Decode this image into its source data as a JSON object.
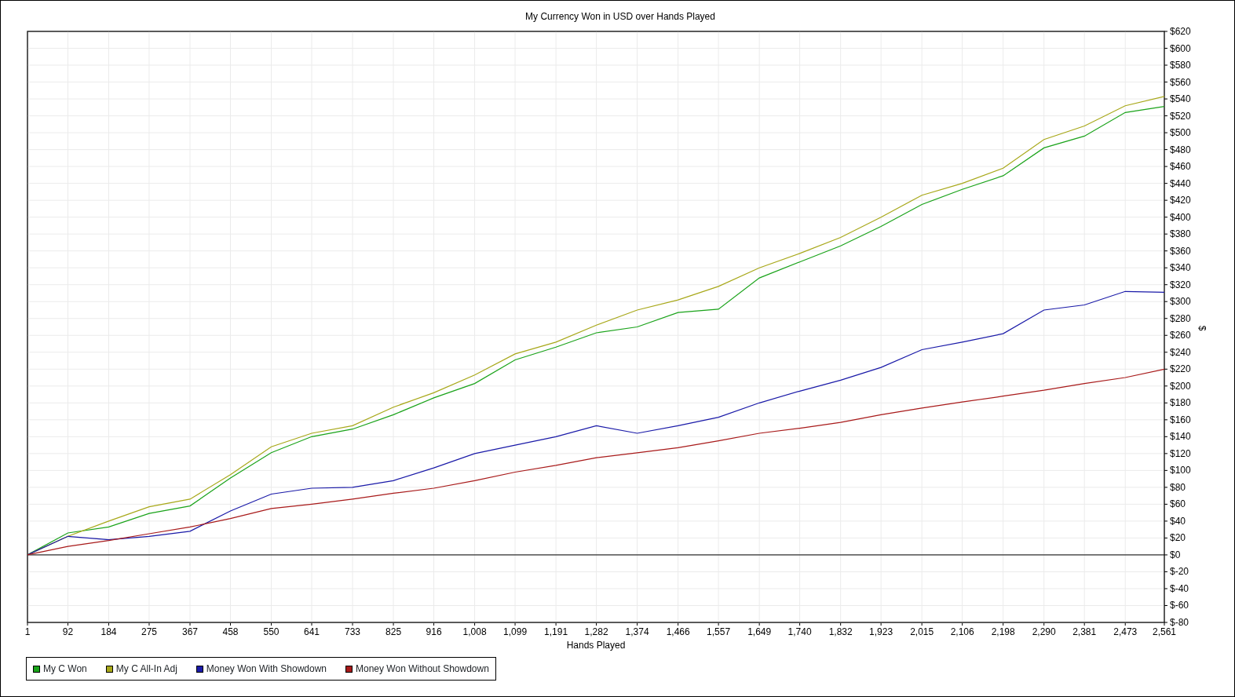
{
  "chart_data": {
    "type": "line",
    "title": "My Currency Won in USD over Hands Played",
    "xlabel": "Hands Played",
    "ylabel": "$",
    "x": [
      1,
      92,
      184,
      275,
      367,
      458,
      550,
      641,
      733,
      825,
      916,
      1008,
      1099,
      1191,
      1282,
      1374,
      1466,
      1557,
      1649,
      1740,
      1832,
      1923,
      2015,
      2106,
      2198,
      2290,
      2381,
      2473,
      2561
    ],
    "series": [
      {
        "name": "My C Won",
        "color": "#1aa31a",
        "values": [
          0,
          26,
          33,
          49,
          58,
          91,
          121,
          140,
          149,
          166,
          186,
          203,
          231,
          246,
          263,
          270,
          287,
          291,
          328,
          347,
          366,
          389,
          415,
          433,
          449,
          482,
          496,
          524,
          531
        ]
      },
      {
        "name": "My C All-In Adj",
        "color": "#a8a81a",
        "values": [
          0,
          22,
          40,
          57,
          66,
          95,
          128,
          144,
          153,
          175,
          192,
          213,
          238,
          252,
          272,
          290,
          302,
          318,
          340,
          357,
          376,
          400,
          426,
          440,
          458,
          492,
          508,
          532,
          543
        ]
      },
      {
        "name": "Money Won With Showdown",
        "color": "#1a1aa8",
        "values": [
          0,
          22,
          18,
          22,
          28,
          52,
          72,
          79,
          80,
          88,
          103,
          120,
          130,
          140,
          153,
          144,
          153,
          163,
          180,
          194,
          207,
          222,
          243,
          252,
          262,
          290,
          296,
          312,
          311
        ]
      },
      {
        "name": "Money Won Without Showdown",
        "color": "#a81a1a",
        "values": [
          0,
          10,
          17,
          25,
          33,
          43,
          55,
          60,
          66,
          73,
          79,
          88,
          98,
          106,
          115,
          121,
          127,
          135,
          144,
          150,
          157,
          166,
          174,
          181,
          188,
          195,
          203,
          210,
          220
        ]
      }
    ],
    "xlim": [
      1,
      2561
    ],
    "ylim": [
      -80,
      620
    ],
    "grid": true,
    "xticks": [
      {
        "value": 1,
        "label": "1"
      },
      {
        "value": 92,
        "label": "92"
      },
      {
        "value": 184,
        "label": "184"
      },
      {
        "value": 275,
        "label": "275"
      },
      {
        "value": 367,
        "label": "367"
      },
      {
        "value": 458,
        "label": "458"
      },
      {
        "value": 550,
        "label": "550"
      },
      {
        "value": 641,
        "label": "641"
      },
      {
        "value": 733,
        "label": "733"
      },
      {
        "value": 825,
        "label": "825"
      },
      {
        "value": 916,
        "label": "916"
      },
      {
        "value": 1008,
        "label": "1,008"
      },
      {
        "value": 1099,
        "label": "1,099"
      },
      {
        "value": 1191,
        "label": "1,191"
      },
      {
        "value": 1282,
        "label": "1,282"
      },
      {
        "value": 1374,
        "label": "1,374"
      },
      {
        "value": 1466,
        "label": "1,466"
      },
      {
        "value": 1557,
        "label": "1,557"
      },
      {
        "value": 1649,
        "label": "1,649"
      },
      {
        "value": 1740,
        "label": "1,740"
      },
      {
        "value": 1832,
        "label": "1,832"
      },
      {
        "value": 1923,
        "label": "1,923"
      },
      {
        "value": 2015,
        "label": "2,015"
      },
      {
        "value": 2106,
        "label": "2,106"
      },
      {
        "value": 2198,
        "label": "2,198"
      },
      {
        "value": 2290,
        "label": "2,290"
      },
      {
        "value": 2381,
        "label": "2,381"
      },
      {
        "value": 2473,
        "label": "2,473"
      },
      {
        "value": 2561,
        "label": "2,561"
      }
    ],
    "yticks": [
      {
        "value": -80,
        "label": "$-80"
      },
      {
        "value": -60,
        "label": "$-60"
      },
      {
        "value": -40,
        "label": "$-40"
      },
      {
        "value": -20,
        "label": "$-20"
      },
      {
        "value": 0,
        "label": "$0"
      },
      {
        "value": 20,
        "label": "$20"
      },
      {
        "value": 40,
        "label": "$40"
      },
      {
        "value": 60,
        "label": "$60"
      },
      {
        "value": 80,
        "label": "$80"
      },
      {
        "value": 100,
        "label": "$100"
      },
      {
        "value": 120,
        "label": "$120"
      },
      {
        "value": 140,
        "label": "$140"
      },
      {
        "value": 160,
        "label": "$160"
      },
      {
        "value": 180,
        "label": "$180"
      },
      {
        "value": 200,
        "label": "$200"
      },
      {
        "value": 220,
        "label": "$220"
      },
      {
        "value": 240,
        "label": "$240"
      },
      {
        "value": 260,
        "label": "$260"
      },
      {
        "value": 280,
        "label": "$280"
      },
      {
        "value": 300,
        "label": "$300"
      },
      {
        "value": 320,
        "label": "$320"
      },
      {
        "value": 340,
        "label": "$340"
      },
      {
        "value": 360,
        "label": "$360"
      },
      {
        "value": 380,
        "label": "$380"
      },
      {
        "value": 400,
        "label": "$400"
      },
      {
        "value": 420,
        "label": "$420"
      },
      {
        "value": 440,
        "label": "$440"
      },
      {
        "value": 460,
        "label": "$460"
      },
      {
        "value": 480,
        "label": "$480"
      },
      {
        "value": 500,
        "label": "$500"
      },
      {
        "value": 520,
        "label": "$520"
      },
      {
        "value": 540,
        "label": "$540"
      },
      {
        "value": 560,
        "label": "$560"
      },
      {
        "value": 580,
        "label": "$580"
      },
      {
        "value": 600,
        "label": "$600"
      },
      {
        "value": 620,
        "label": "$620"
      }
    ]
  }
}
